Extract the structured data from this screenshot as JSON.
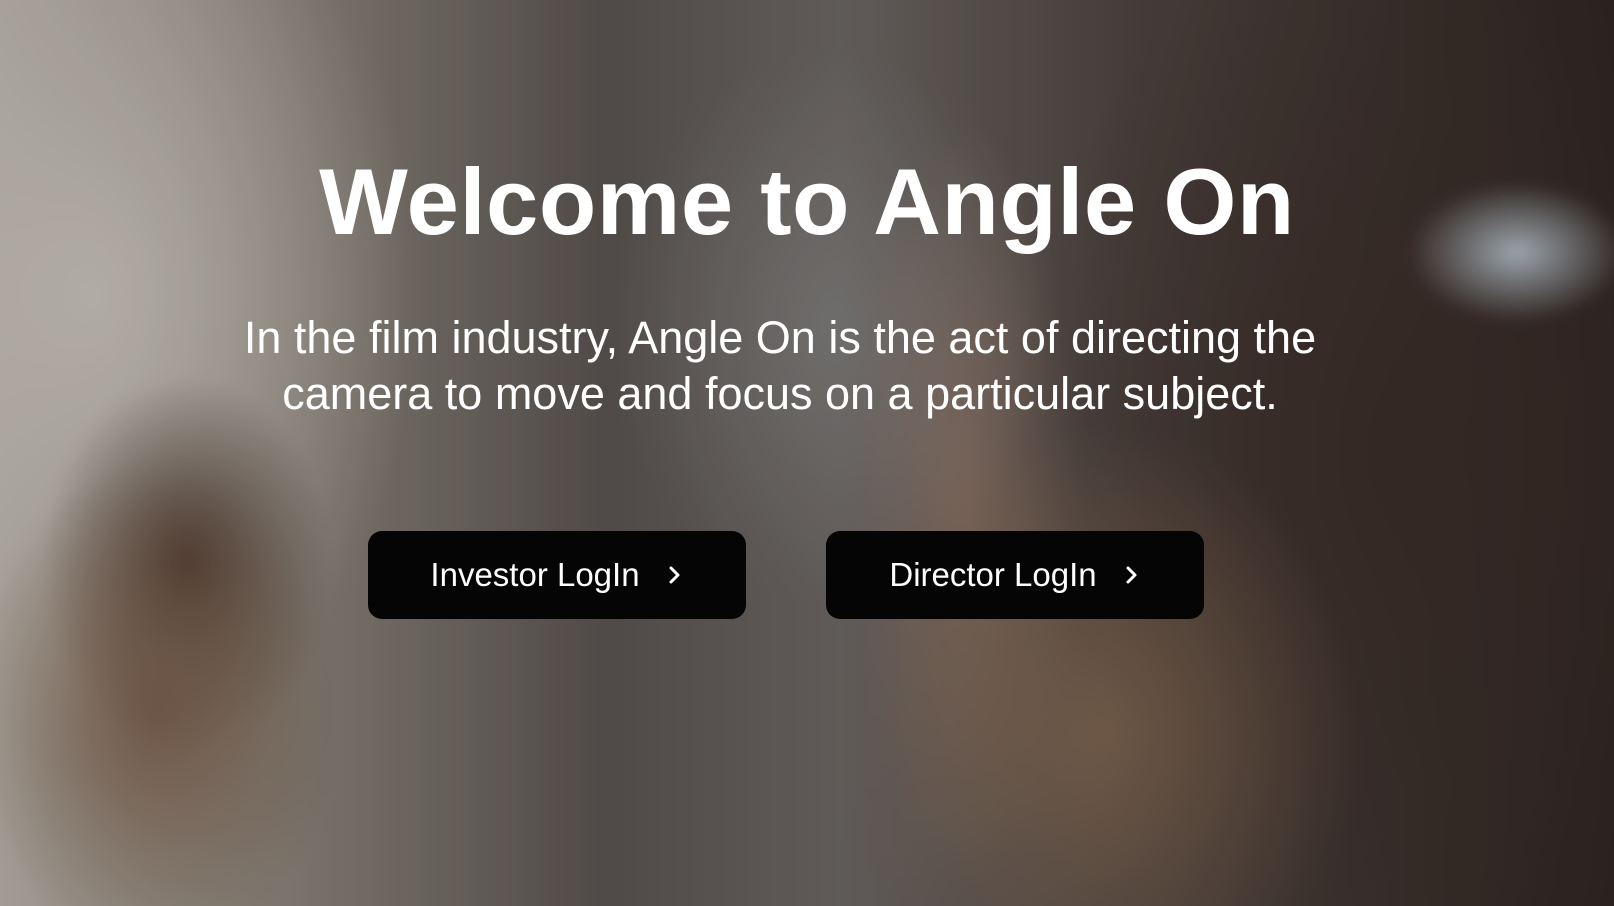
{
  "hero": {
    "title": "Welcome to Angle On",
    "subtitle": "In the film industry, Angle On is the act of directing the camera to move and focus on a particular subject."
  },
  "buttons": {
    "investor": {
      "label": "Investor LogIn",
      "icon": "chevron-right-icon"
    },
    "director": {
      "label": "Director LogIn",
      "icon": "chevron-right-icon"
    }
  },
  "colors": {
    "text": "#ffffff",
    "button_bg": "#050505"
  }
}
